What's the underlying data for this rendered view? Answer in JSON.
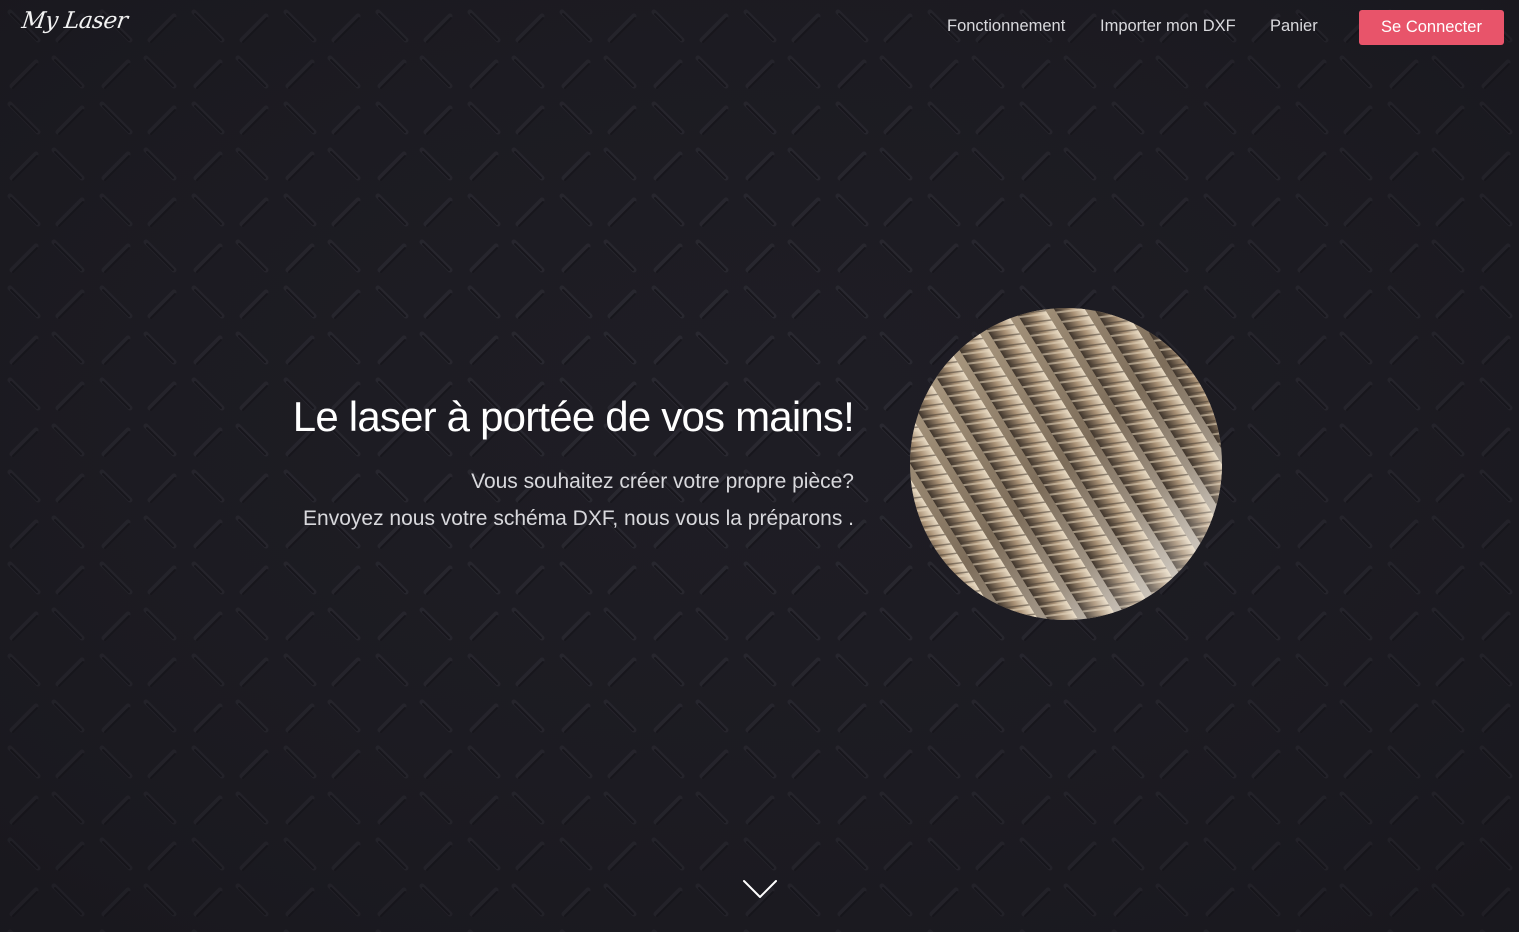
{
  "logo": {
    "text": "My Laser"
  },
  "nav": {
    "items": [
      {
        "label": "Fonctionnement"
      },
      {
        "label": "Importer mon DXF"
      },
      {
        "label": "Panier"
      }
    ],
    "login_label": "Se Connecter"
  },
  "hero": {
    "title": "Le laser à portée de vos mains!",
    "line1": "Vous souhaitez créer votre propre pièce?",
    "line2": "Envoyez nous votre schéma DXF, nous vous la préparons ."
  },
  "icons": {
    "scroll_down": "chevron-down-icon",
    "hero_image": "rebar-photo"
  },
  "colors": {
    "background": "#1e1d24",
    "accent": "#e8546a",
    "text": "#ffffff",
    "nav_text": "#d9d9dd"
  }
}
